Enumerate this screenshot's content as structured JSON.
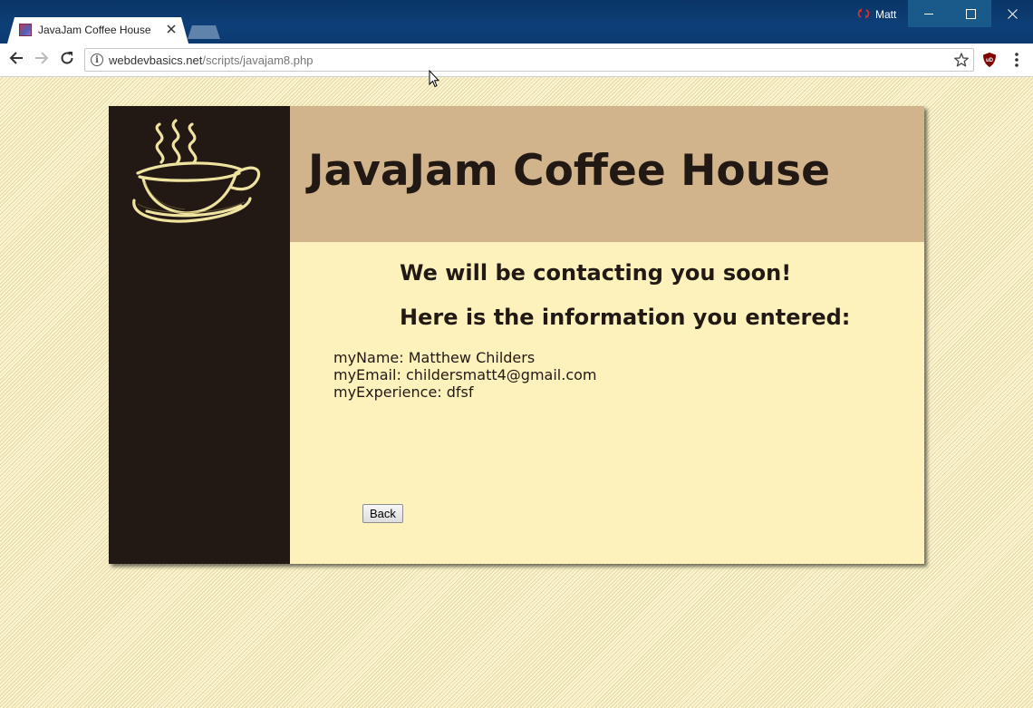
{
  "browser": {
    "tab": {
      "title": "JavaJam Coffee House"
    },
    "profile": {
      "name": "Matt"
    },
    "url": {
      "domain": "webdevbasics.net",
      "path": "/scripts/javajam8.php"
    }
  },
  "site": {
    "title": "JavaJam Coffee House",
    "headings": {
      "contact": "We will be contacting you soon!",
      "info": "Here is the information you entered:"
    },
    "entries": [
      {
        "label": "myName:",
        "value": "Matthew Childers"
      },
      {
        "label": "myEmail:",
        "value": "childersmatt4@gmail.com"
      },
      {
        "label": "myExperience:",
        "value": "dfsf"
      }
    ],
    "back_button": "Back"
  },
  "colors": {
    "titlebar": "#0b3a70",
    "sidebar": "#221814",
    "header": "#d2b48c",
    "content": "#fdf2bc",
    "text": "#221814"
  },
  "icons": [
    "favicon-icon",
    "close-icon",
    "new-tab-icon",
    "profile-sync-icon",
    "minimize-icon",
    "maximize-icon",
    "window-close-icon",
    "back-arrow-icon",
    "forward-arrow-icon",
    "reload-icon",
    "info-icon",
    "bookmark-star-icon",
    "ublock-icon",
    "menu-dots-icon",
    "coffee-cup-logo",
    "mouse-cursor-icon"
  ]
}
